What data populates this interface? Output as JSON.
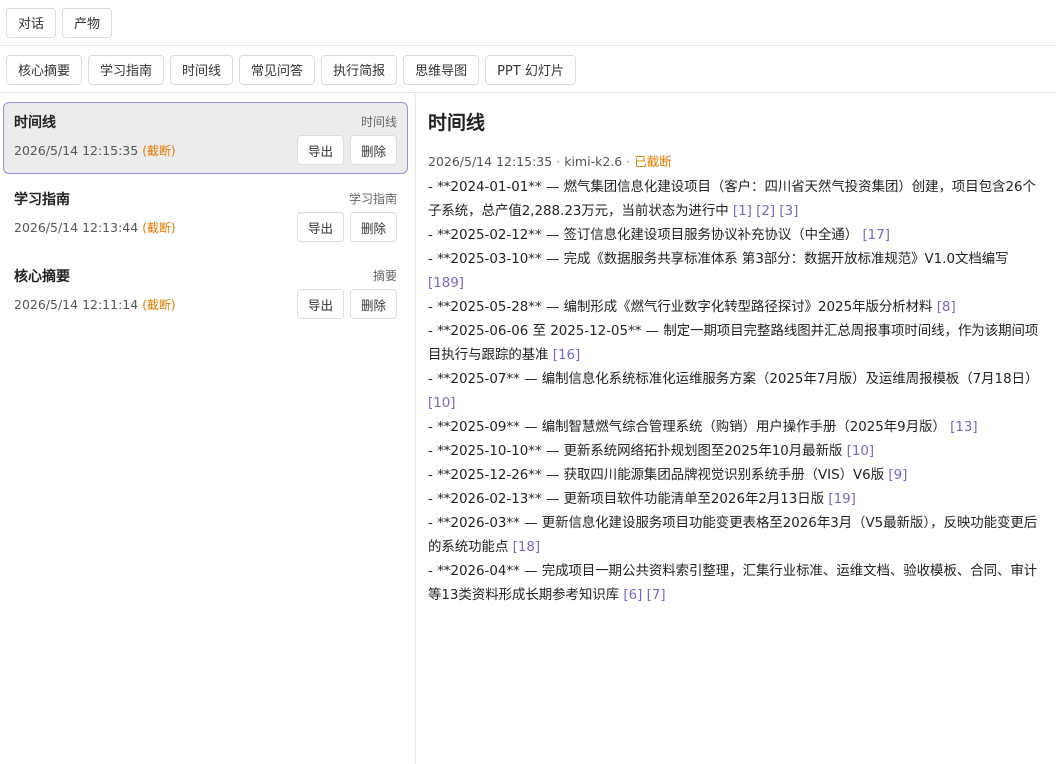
{
  "top_tabs": [
    "对话",
    "产物"
  ],
  "tools": [
    "核心摘要",
    "学习指南",
    "时间线",
    "常见问答",
    "执行简报",
    "思维导图",
    "PPT 幻灯片"
  ],
  "items": [
    {
      "title": "时间线",
      "type": "时间线",
      "date": "2026/5/14 12:15:35",
      "flag": "(截断)",
      "export": "导出",
      "delete": "删除",
      "active": true
    },
    {
      "title": "学习指南",
      "type": "学习指南",
      "date": "2026/5/14 12:13:44",
      "flag": "(截断)",
      "export": "导出",
      "delete": "删除",
      "active": false
    },
    {
      "title": "核心摘要",
      "type": "摘要",
      "date": "2026/5/14 12:11:14",
      "flag": "(截断)",
      "export": "导出",
      "delete": "删除",
      "active": false
    }
  ],
  "content": {
    "title": "时间线",
    "date": "2026/5/14 12:15:35",
    "model": "kimi-k2.6",
    "status": "已截断",
    "lines": [
      {
        "text": "- **2024-01-01** — 燃气集团信息化建设项目（客户：四川省天然气投资集团）创建，项目包含26个子系统，总产值2,288.23万元，当前状态为进行中 ",
        "refs": "[1] [2] [3]"
      },
      {
        "text": "- **2025-02-12** — 签订信息化建设项目服务协议补充协议（中全通） ",
        "refs": "[17]"
      },
      {
        "text": "- **2025-03-10** — 完成《数据服务共享标准体系 第3部分：数据开放标准规范》V1.0文档编写 ",
        "refs": "[189]"
      },
      {
        "text": "- **2025-05-28** — 编制形成《燃气行业数字化转型路径探讨》2025年版分析材料 ",
        "refs": "[8]"
      },
      {
        "text": "- **2025-06-06 至 2025-12-05** — 制定一期项目完整路线图并汇总周报事项时间线，作为该期间项目执行与跟踪的基准 ",
        "refs": "[16]"
      },
      {
        "text": "- **2025-07** — 编制信息化系统标准化运维服务方案（2025年7月版）及运维周报模板（7月18日） ",
        "refs": "[10]"
      },
      {
        "text": "- **2025-09** — 编制智慧燃气综合管理系统（购销）用户操作手册（2025年9月版） ",
        "refs": "[13]"
      },
      {
        "text": "- **2025-10-10** — 更新系统网络拓扑规划图至2025年10月最新版 ",
        "refs": "[10]"
      },
      {
        "text": "- **2025-12-26** — 获取四川能源集团品牌视觉识别系统手册（VIS）V6版 ",
        "refs": "[9]"
      },
      {
        "text": "- **2026-02-13** — 更新项目软件功能清单至2026年2月13日版 ",
        "refs": "[19]"
      },
      {
        "text": "- **2026-03** — 更新信息化建设服务项目功能变更表格至2026年3月（V5最新版），反映功能变更后的系统功能点 ",
        "refs": "[18]"
      },
      {
        "text": "- **2026-04** — 完成项目一期公共资料索引整理，汇集行业标准、运维文档、验收模板、合同、审计等13类资料形成长期参考知识库 ",
        "refs": "[6] [7]"
      }
    ]
  }
}
